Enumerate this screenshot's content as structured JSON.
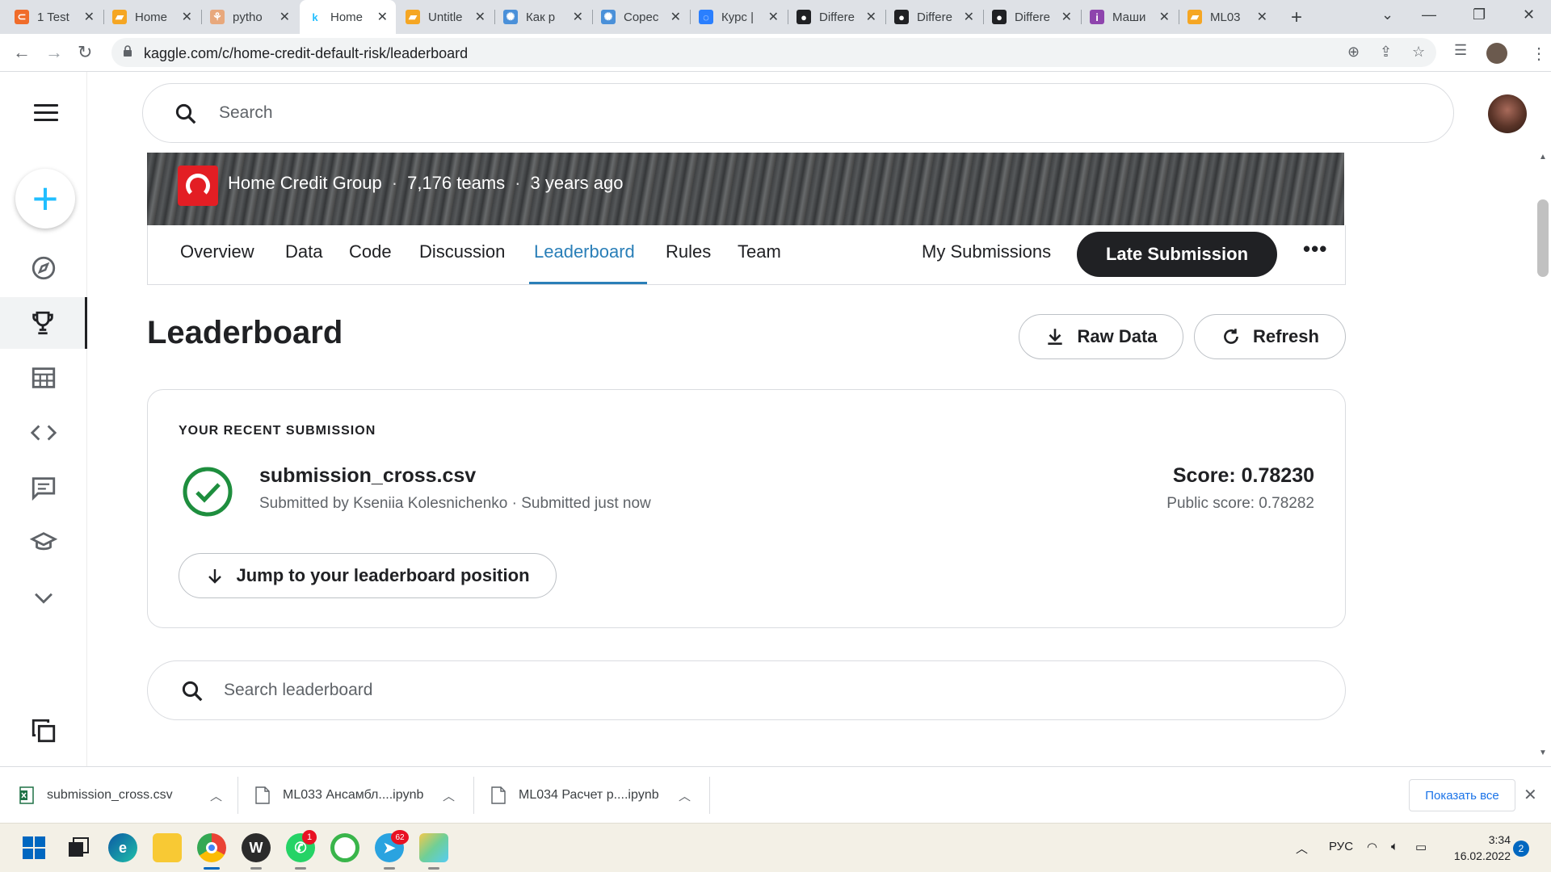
{
  "browser": {
    "tabs": [
      {
        "label": "1 Test",
        "color": "#f06c2a",
        "glyph": "⊂",
        "active": false
      },
      {
        "label": "Home",
        "color": "#f5a623",
        "glyph": "▰",
        "active": false
      },
      {
        "label": "pytho",
        "color": "#e8a87c",
        "glyph": "⚘",
        "active": false
      },
      {
        "label": "Home",
        "color": "#20beff",
        "glyph": "k",
        "active": true
      },
      {
        "label": "Untitle",
        "color": "#f5a623",
        "glyph": "▰",
        "active": false
      },
      {
        "label": "Как р",
        "color": "#4a90d9",
        "glyph": "✺",
        "active": false
      },
      {
        "label": "Copec",
        "color": "#4a90d9",
        "glyph": "✺",
        "active": false
      },
      {
        "label": "Курс |",
        "color": "#2a7fff",
        "glyph": "◌",
        "active": false
      },
      {
        "label": "Differe",
        "color": "#202124",
        "glyph": "●",
        "active": false
      },
      {
        "label": "Differe",
        "color": "#202124",
        "glyph": "●",
        "active": false
      },
      {
        "label": "Differe",
        "color": "#202124",
        "glyph": "●",
        "active": false
      },
      {
        "label": "Маши",
        "color": "#8e44ad",
        "glyph": "i",
        "active": false
      },
      {
        "label": "ML03",
        "color": "#f5a623",
        "glyph": "▰",
        "active": false
      }
    ],
    "url": "kaggle.com/c/home-credit-default-risk/leaderboard"
  },
  "kaggle": {
    "search_placeholder": "Search",
    "competition": {
      "host": "Home Credit Group",
      "teams": "7,176 teams",
      "age": "3 years ago"
    },
    "tabs": {
      "overview": "Overview",
      "data": "Data",
      "code": "Code",
      "discussion": "Discussion",
      "leaderboard": "Leaderboard",
      "rules": "Rules",
      "team": "Team",
      "my_submissions": "My Submissions",
      "late_submission": "Late Submission"
    },
    "leaderboard": {
      "title": "Leaderboard",
      "raw_data": "Raw Data",
      "refresh": "Refresh"
    },
    "recent": {
      "caption": "YOUR RECENT SUBMISSION",
      "file": "submission_cross.csv",
      "meta": "Submitted by Kseniia Kolesnichenko · Submitted just now",
      "score": "Score: 0.78230",
      "public_score": "Public score: 0.78282",
      "jump": "Jump to your leaderboard position"
    },
    "lb_search_placeholder": "Search leaderboard"
  },
  "downloads": {
    "items": [
      "submission_cross.csv",
      "ML033 Ансамбл....ipynb",
      "ML034 Расчет р....ipynb"
    ],
    "show_all": "Показать все"
  },
  "taskbar": {
    "whatsapp_badge": "1",
    "telegram_badge": "62",
    "lang": "РУС",
    "time": "3:34",
    "date": "16.02.2022",
    "notifications": "2"
  }
}
